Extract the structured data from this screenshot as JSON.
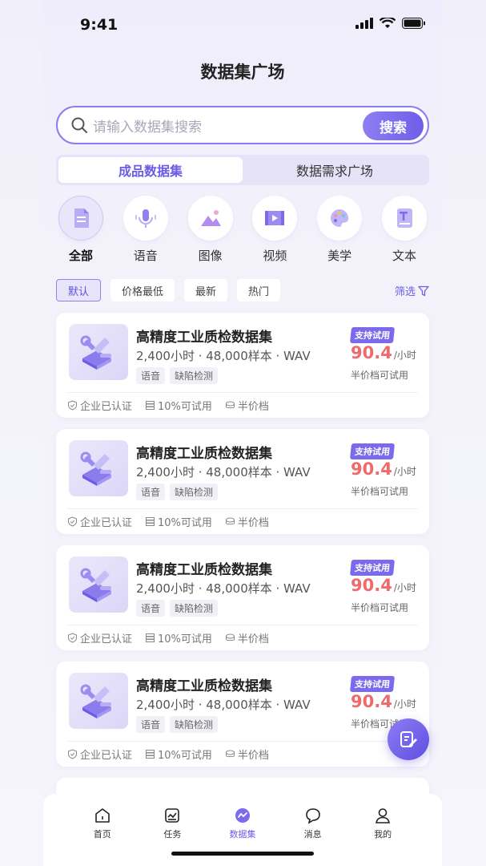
{
  "status": {
    "time": "9:41"
  },
  "page": {
    "title": "数据集广场"
  },
  "search": {
    "placeholder": "请输入数据集搜索",
    "button": "搜索"
  },
  "segment": {
    "tabs": [
      "成品数据集",
      "数据需求广场"
    ],
    "active_index": 0
  },
  "categories": [
    {
      "label": "全部",
      "icon": "document-icon",
      "active": true
    },
    {
      "label": "语音",
      "icon": "microphone-icon",
      "active": false
    },
    {
      "label": "图像",
      "icon": "image-icon",
      "active": false
    },
    {
      "label": "视频",
      "icon": "video-icon",
      "active": false
    },
    {
      "label": "美学",
      "icon": "palette-icon",
      "active": false
    },
    {
      "label": "文本",
      "icon": "text-icon",
      "active": false
    }
  ],
  "filters": {
    "chips": [
      "默认",
      "价格最低",
      "最新",
      "热门"
    ],
    "active_index": 0,
    "filter_label": "筛选"
  },
  "datasets": [
    {
      "title": "高精度工业质检数据集",
      "meta": "2,400小时 · 48,000样本 · WAV",
      "tags": [
        "语音",
        "缺陷检测"
      ],
      "badge": "支持试用",
      "price": "90.4",
      "unit": "/小时",
      "note": "半价档可试用",
      "footer": [
        "企业已认证",
        "10%可试用",
        "半价档"
      ]
    },
    {
      "title": "高精度工业质检数据集",
      "meta": "2,400小时 · 48,000样本 · WAV",
      "tags": [
        "语音",
        "缺陷检测"
      ],
      "badge": "支持试用",
      "price": "90.4",
      "unit": "/小时",
      "note": "半价档可试用",
      "footer": [
        "企业已认证",
        "10%可试用",
        "半价档"
      ]
    },
    {
      "title": "高精度工业质检数据集",
      "meta": "2,400小时 · 48,000样本 · WAV",
      "tags": [
        "语音",
        "缺陷检测"
      ],
      "badge": "支持试用",
      "price": "90.4",
      "unit": "/小时",
      "note": "半价档可试用",
      "footer": [
        "企业已认证",
        "10%可试用",
        "半价档"
      ]
    },
    {
      "title": "高精度工业质检数据集",
      "meta": "2,400小时 · 48,000样本 · WAV",
      "tags": [
        "语音",
        "缺陷检测"
      ],
      "badge": "支持试用",
      "price": "90.4",
      "unit": "/小时",
      "note": "半价档可试用",
      "footer": [
        "企业已认证",
        "10%可试用",
        "半价档"
      ]
    }
  ],
  "tabbar": [
    {
      "label": "首页",
      "icon": "home-icon",
      "active": false
    },
    {
      "label": "任务",
      "icon": "task-icon",
      "active": false
    },
    {
      "label": "数据集",
      "icon": "dataset-icon",
      "active": true
    },
    {
      "label": "消息",
      "icon": "message-icon",
      "active": false
    },
    {
      "label": "我的",
      "icon": "profile-icon",
      "active": false
    }
  ],
  "colors": {
    "accent": "#6b5ce7",
    "price": "#ef6b6b"
  }
}
